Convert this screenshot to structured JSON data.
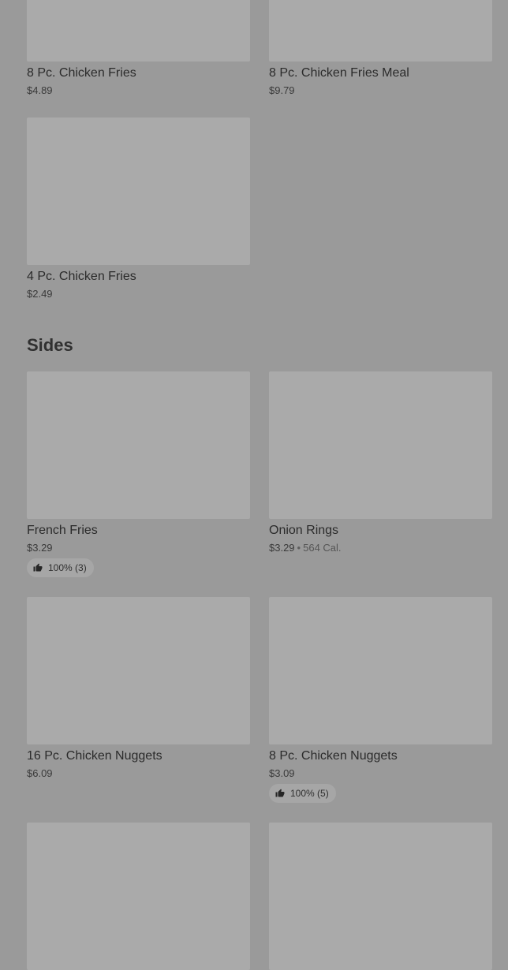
{
  "top_items": [
    {
      "name": "8 Pc. Chicken Fries",
      "price": "$4.89"
    },
    {
      "name": "8 Pc. Chicken Fries Meal",
      "price": "$9.79"
    },
    {
      "name": "4 Pc. Chicken Fries",
      "price": "$2.49"
    }
  ],
  "sides": {
    "title": "Sides",
    "items": [
      {
        "name": "French Fries",
        "price": "$3.29",
        "rating": "100% (3)"
      },
      {
        "name": "Onion Rings",
        "price": "$3.29",
        "separator": "•",
        "calories": "564 Cal."
      },
      {
        "name": "16 Pc. Chicken Nuggets",
        "price": "$6.09"
      },
      {
        "name": "8 Pc. Chicken Nuggets",
        "price": "$3.09",
        "rating": "100% (5)"
      }
    ]
  },
  "icons": {
    "rating": "thumbs-up-icon"
  }
}
